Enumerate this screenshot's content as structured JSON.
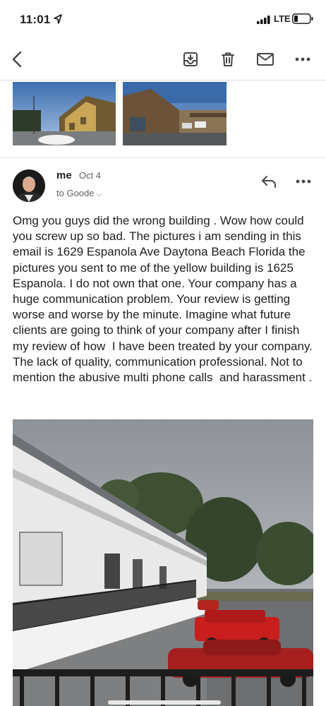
{
  "status_bar": {
    "time": "11:01",
    "network": "LTE"
  },
  "toolbar": {
    "back_icon": "chevron-left-icon",
    "archive_icon": "archive-icon",
    "delete_icon": "trash-icon",
    "mark_unread_icon": "mail-icon",
    "more_icon": "more-horizontal-icon"
  },
  "message": {
    "sender": "me",
    "date": "Oct 4",
    "recipient_prefix": "to Goode",
    "body": "Omg you guys did the wrong building . Wow how could you screw up so bad. The pictures i am sending in this email is 1629 Espanola Ave Daytona Beach Florida the pictures you sent to me of the yellow building is 1625 Espanola. I do not own that one. Your company has a huge communication problem. Your review is getting worse and worse by the minute. Imagine what future clients are going to think of your company after I finish my review of how  I have been treated by your company. The lack of quality, communication professional. Not to mention the abusive multi phone calls  and harassment ."
  },
  "colors": {
    "text": "#202124",
    "secondary": "#5f6368",
    "icon": "#444746"
  }
}
